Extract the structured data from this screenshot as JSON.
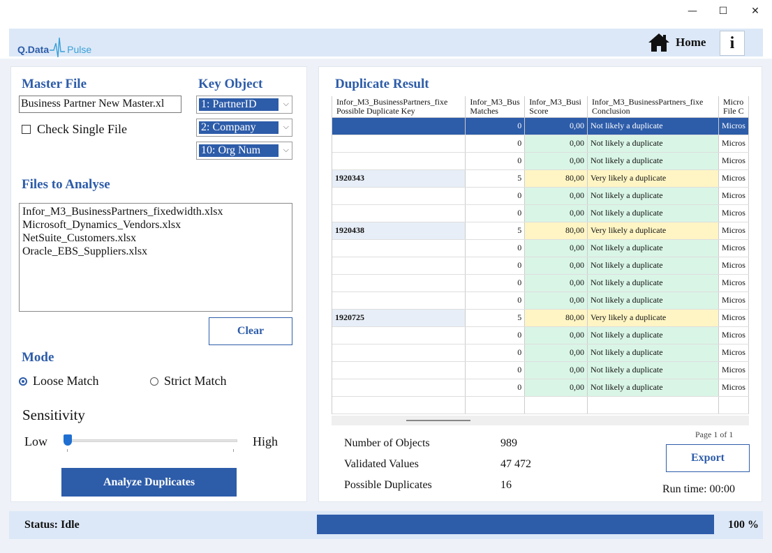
{
  "window": {
    "minimize": "—",
    "maximize": "☐",
    "close": "✕"
  },
  "header": {
    "logo_left": "Q.Data",
    "logo_right": "Pulse",
    "home_label": "Home",
    "info_label": "i"
  },
  "master": {
    "title": "Master File",
    "file_value": "Business Partner New Master.xl",
    "check_single_label": "Check Single File"
  },
  "key_object": {
    "title": "Key Object",
    "selects": [
      "1: PartnerID",
      "2: Company",
      "10: Org Num"
    ]
  },
  "files": {
    "title": "Files to Analyse",
    "items": [
      "Infor_M3_BusinessPartners_fixedwidth.xlsx",
      "Microsoft_Dynamics_Vendors.xlsx",
      "NetSuite_Customers.xlsx",
      "Oracle_EBS_Suppliers.xlsx"
    ],
    "clear_label": "Clear"
  },
  "mode": {
    "title": "Mode",
    "loose_label": "Loose Match",
    "strict_label": "Strict Match",
    "selected": "loose"
  },
  "sensitivity": {
    "title": "Sensitivity",
    "low": "Low",
    "high": "High",
    "level": 0.0
  },
  "analyze_label": "Analyze Duplicates",
  "results": {
    "title": "Duplicate Result",
    "columns": [
      [
        "Infor_M3_BusinessPartners_fixe",
        "Possible Duplicate Key"
      ],
      [
        "Infor_M3_Bus",
        "Matches"
      ],
      [
        "Infor_M3_Busi",
        "Score"
      ],
      [
        "Infor_M3_BusinessPartners_fixe",
        "Conclusion"
      ],
      [
        "Micro",
        "File C"
      ]
    ],
    "rows": [
      {
        "key": "",
        "matches": "0",
        "score": "0,00",
        "conclusion": "Not likely a duplicate",
        "file": "Micros",
        "type": "selected"
      },
      {
        "key": "",
        "matches": "0",
        "score": "0,00",
        "conclusion": "Not likely a duplicate",
        "file": "Micros",
        "type": "green"
      },
      {
        "key": "",
        "matches": "0",
        "score": "0,00",
        "conclusion": "Not likely a duplicate",
        "file": "Micros",
        "type": "green"
      },
      {
        "key": "1920343",
        "matches": "5",
        "score": "80,00",
        "conclusion": "Very likely a duplicate",
        "file": "Micros",
        "type": "yellow"
      },
      {
        "key": "",
        "matches": "0",
        "score": "0,00",
        "conclusion": "Not likely a duplicate",
        "file": "Micros",
        "type": "green"
      },
      {
        "key": "",
        "matches": "0",
        "score": "0,00",
        "conclusion": "Not likely a duplicate",
        "file": "Micros",
        "type": "green"
      },
      {
        "key": "1920438",
        "matches": "5",
        "score": "80,00",
        "conclusion": "Very likely a duplicate",
        "file": "Micros",
        "type": "yellow"
      },
      {
        "key": "",
        "matches": "0",
        "score": "0,00",
        "conclusion": "Not likely a duplicate",
        "file": "Micros",
        "type": "green"
      },
      {
        "key": "",
        "matches": "0",
        "score": "0,00",
        "conclusion": "Not likely a duplicate",
        "file": "Micros",
        "type": "green"
      },
      {
        "key": "",
        "matches": "0",
        "score": "0,00",
        "conclusion": "Not likely a duplicate",
        "file": "Micros",
        "type": "green"
      },
      {
        "key": "",
        "matches": "0",
        "score": "0,00",
        "conclusion": "Not likely a duplicate",
        "file": "Micros",
        "type": "green"
      },
      {
        "key": "1920725",
        "matches": "5",
        "score": "80,00",
        "conclusion": "Very likely a duplicate",
        "file": "Micros",
        "type": "yellow"
      },
      {
        "key": "",
        "matches": "0",
        "score": "0,00",
        "conclusion": "Not likely a duplicate",
        "file": "Micros",
        "type": "green"
      },
      {
        "key": "",
        "matches": "0",
        "score": "0,00",
        "conclusion": "Not likely a duplicate",
        "file": "Micros",
        "type": "green"
      },
      {
        "key": "",
        "matches": "0",
        "score": "0,00",
        "conclusion": "Not likely a duplicate",
        "file": "Micros",
        "type": "green"
      },
      {
        "key": "",
        "matches": "0",
        "score": "0,00",
        "conclusion": "Not likely a duplicate",
        "file": "Micros",
        "type": "green"
      },
      {
        "key": "",
        "matches": "",
        "score": "",
        "conclusion": "",
        "file": "",
        "type": "empty"
      }
    ],
    "page_info": "Page 1 of 1",
    "stats": [
      {
        "label": "Number of Objects",
        "value": "989"
      },
      {
        "label": "Validated Values",
        "value": "47 472"
      },
      {
        "label": "Possible Duplicates",
        "value": "16"
      }
    ],
    "export_label": "Export",
    "runtime": "Run time: 00:00"
  },
  "status": {
    "text": "Status: Idle",
    "progress_percent": 100,
    "progress_label": "100 %"
  },
  "colors": {
    "accent": "#2d5ca9",
    "header_bg": "#dce8f7",
    "score_green": "#d9f5e6",
    "score_yellow": "#fff5c4"
  }
}
